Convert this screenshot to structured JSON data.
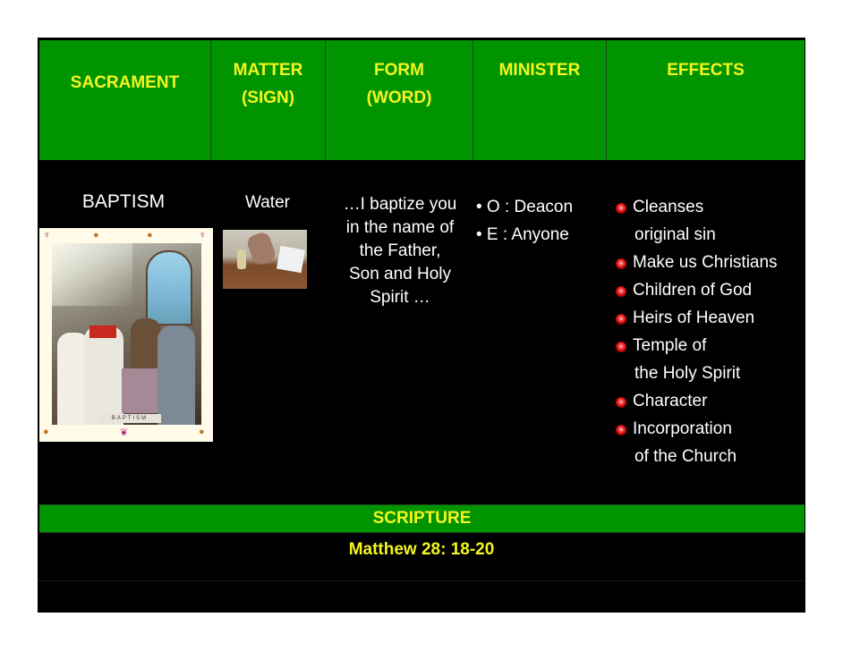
{
  "header": {
    "sacrament": "SACRAMENT",
    "matter_line1": "MATTER",
    "matter_line2": "(SIGN)",
    "form_line1": "FORM",
    "form_line2": "(WORD)",
    "minister": "MINISTER",
    "effects": "EFFECTS"
  },
  "row": {
    "sacrament": "BAPTISM",
    "matter": "Water",
    "form_lines": [
      "…I baptize you",
      "in the name of",
      "the Father,",
      "Son and Holy",
      "Spirit …"
    ],
    "minister": [
      "• O : Deacon",
      "• E : Anyone"
    ],
    "effects": [
      {
        "text": "Cleanses",
        "bullet": true
      },
      {
        "text": "original sin",
        "bullet": false
      },
      {
        "text": "Make us Christians",
        "bullet": true
      },
      {
        "text": "Children of God",
        "bullet": true
      },
      {
        "text": "Heirs of Heaven",
        "bullet": true
      },
      {
        "text": "Temple of",
        "bullet": true
      },
      {
        "text": "the Holy Spirit",
        "bullet": false
      },
      {
        "text": "Character",
        "bullet": true
      },
      {
        "text": "Incorporation",
        "bullet": true
      },
      {
        "text": "of the Church",
        "bullet": false
      }
    ],
    "image_caption": "BAPTISM"
  },
  "scripture": {
    "label": "SCRIPTURE",
    "reference": "Matthew 28: 18-20"
  },
  "colors": {
    "header_green": "#009500",
    "header_text_yellow": "#f5f520",
    "background": "#000000",
    "body_text": "#ffffff",
    "bullet_red": "#d01010"
  }
}
